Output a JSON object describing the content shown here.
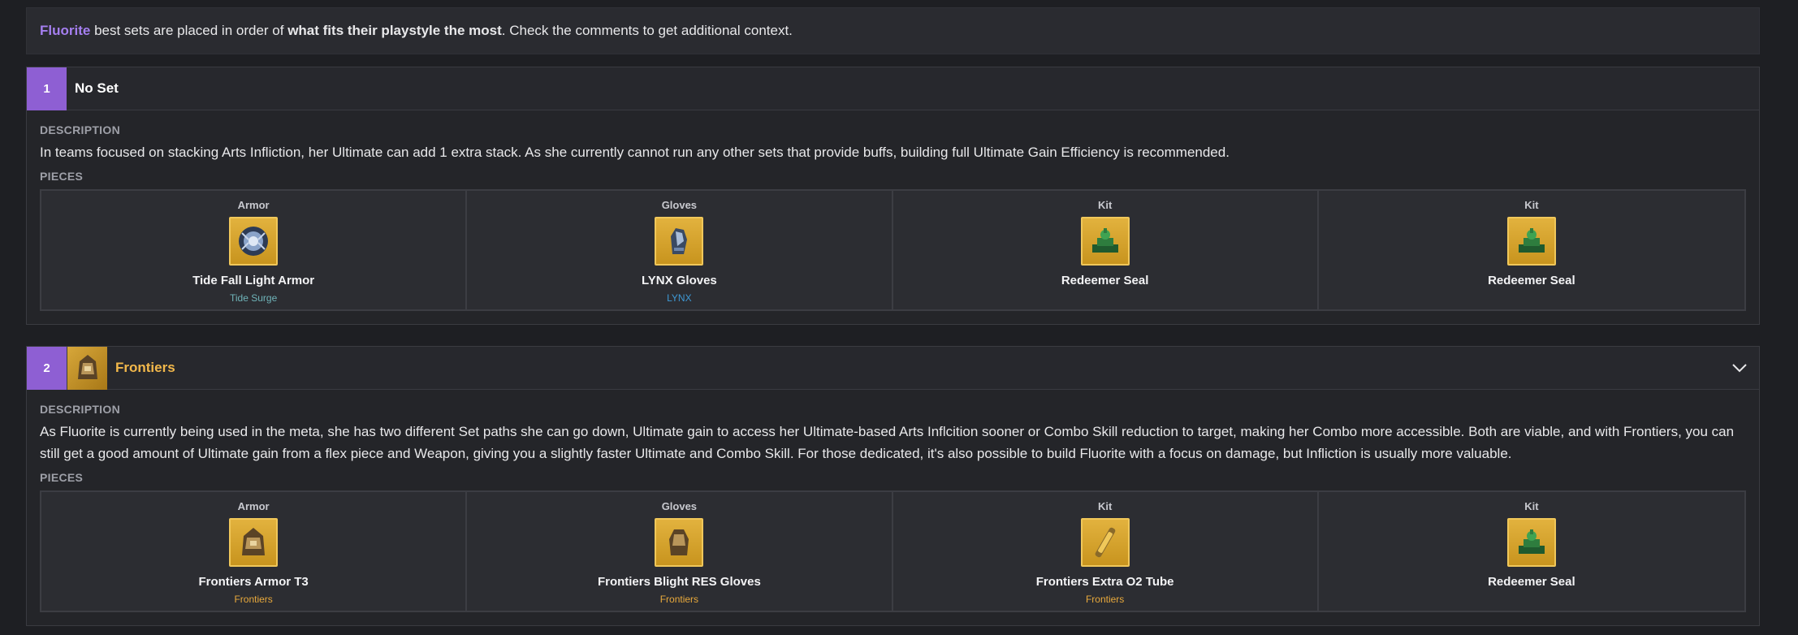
{
  "intro": {
    "character": "Fluorite",
    "text_a": " best sets are placed in order of ",
    "bold": "what fits their playstyle the most",
    "text_b": ". Check the comments to get additional context."
  },
  "labels": {
    "description": "DESCRIPTION",
    "pieces": "PIECES"
  },
  "colors": {
    "accent_purple": "#8e5fd3",
    "gold": "#f2b84b",
    "teal": "#6fb3b8",
    "blue": "#3e98d4"
  },
  "sets": [
    {
      "rank": "1",
      "name": "No Set",
      "description": "In teams focused on stacking Arts Infliction, her Ultimate can add 1 extra stack. As she currently cannot run any other sets that provide buffs, building full Ultimate Gain Efficiency is recommended.",
      "pieces": [
        {
          "slot": "Armor",
          "name": "Tide Fall Light Armor",
          "set": "Tide Surge",
          "icon": "armor-icon"
        },
        {
          "slot": "Gloves",
          "name": "LYNX Gloves",
          "set": "LYNX",
          "icon": "gloves-icon"
        },
        {
          "slot": "Kit",
          "name": "Redeemer Seal",
          "set": "",
          "icon": "seal-icon"
        },
        {
          "slot": "Kit",
          "name": "Redeemer Seal",
          "set": "",
          "icon": "seal-icon"
        }
      ]
    },
    {
      "rank": "2",
      "name": "Frontiers",
      "description": "As Fluorite is currently being used in the meta, she has two different Set paths she can go down, Ultimate gain to access her Ultimate-based Arts Inflcition sooner or Combo Skill reduction to target, making her Combo more accessible. Both are viable, and with Frontiers, you can still get a good amount of Ultimate gain from a flex piece and Weapon, giving you a slightly faster Ultimate and Combo Skill. For those dedicated, it's also possible to build Fluorite with a focus on damage, but Infliction is usually more valuable.",
      "pieces": [
        {
          "slot": "Armor",
          "name": "Frontiers Armor T3",
          "set": "Frontiers",
          "icon": "armor-icon"
        },
        {
          "slot": "Gloves",
          "name": "Frontiers Blight RES Gloves",
          "set": "Frontiers",
          "icon": "gloves-icon"
        },
        {
          "slot": "Kit",
          "name": "Frontiers Extra O2 Tube",
          "set": "Frontiers",
          "icon": "tube-icon"
        },
        {
          "slot": "Kit",
          "name": "Redeemer Seal",
          "set": "",
          "icon": "seal-icon"
        }
      ]
    }
  ]
}
